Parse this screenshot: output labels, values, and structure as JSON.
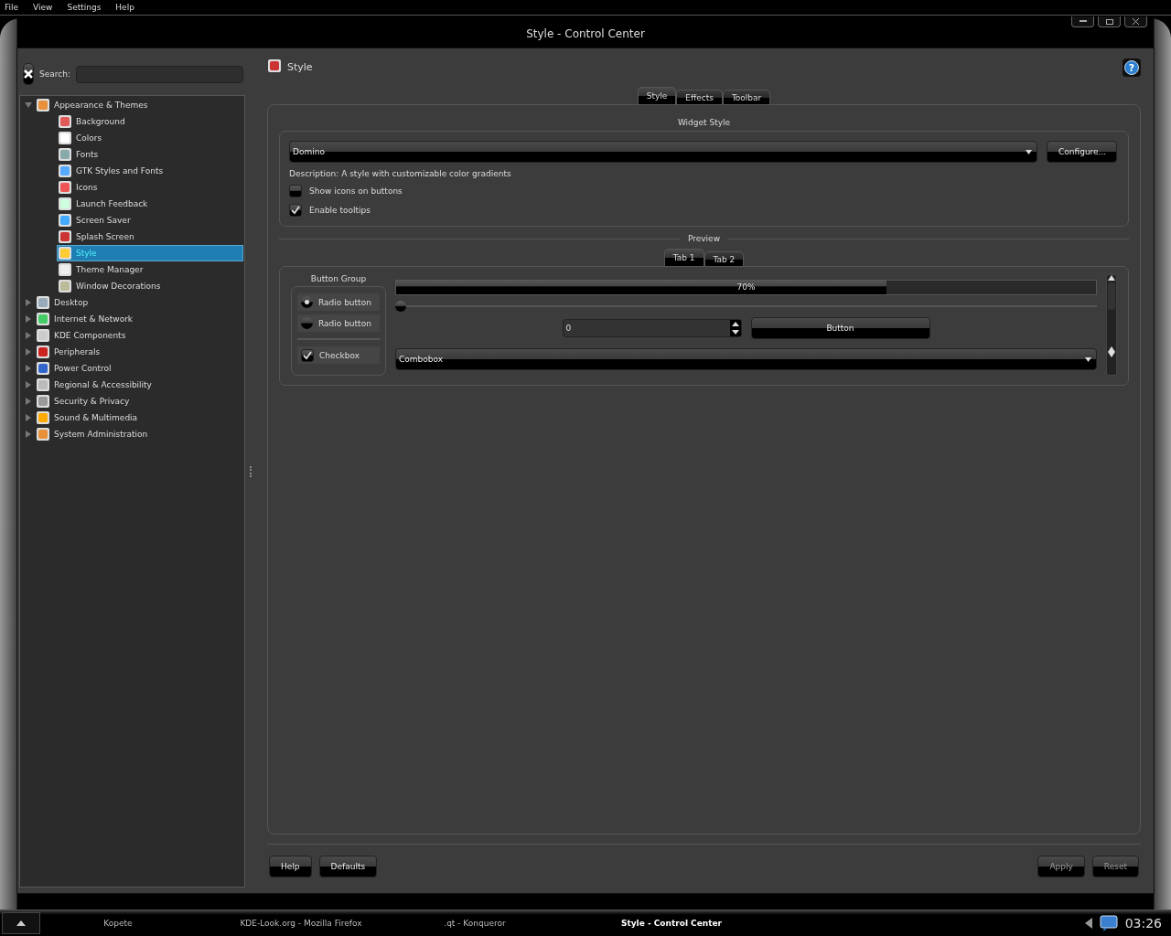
{
  "menubar": [
    "File",
    "View",
    "Settings",
    "Help"
  ],
  "window": {
    "title": "Style - Control Center"
  },
  "sidebar": {
    "search_label": "Search:"
  },
  "tree": [
    {
      "label": "Appearance & Themes",
      "expanded": true,
      "selected": false,
      "children": [
        {
          "label": "Background",
          "selected": false
        },
        {
          "label": "Colors",
          "selected": false
        },
        {
          "label": "Fonts",
          "selected": false
        },
        {
          "label": "GTK Styles and Fonts",
          "selected": false
        },
        {
          "label": "Icons",
          "selected": false
        },
        {
          "label": "Launch Feedback",
          "selected": false
        },
        {
          "label": "Screen Saver",
          "selected": false
        },
        {
          "label": "Splash Screen",
          "selected": false
        },
        {
          "label": "Style",
          "selected": true
        },
        {
          "label": "Theme Manager",
          "selected": false
        },
        {
          "label": "Window Decorations",
          "selected": false
        }
      ]
    },
    {
      "label": "Desktop",
      "expanded": false,
      "selected": false
    },
    {
      "label": "Internet & Network",
      "expanded": false,
      "selected": false
    },
    {
      "label": "KDE Components",
      "expanded": false,
      "selected": false
    },
    {
      "label": "Peripherals",
      "expanded": false,
      "selected": false
    },
    {
      "label": "Power Control",
      "expanded": false,
      "selected": false
    },
    {
      "label": "Regional & Accessibility",
      "expanded": false,
      "selected": false
    },
    {
      "label": "Security & Privacy",
      "expanded": false,
      "selected": false
    },
    {
      "label": "Sound & Multimedia",
      "expanded": false,
      "selected": false
    },
    {
      "label": "System Administration",
      "expanded": false,
      "selected": false
    }
  ],
  "page": {
    "title": "Style",
    "help_icon": "?"
  },
  "tabs": [
    {
      "label": "Style",
      "selected": true
    },
    {
      "label": "Effects",
      "selected": false
    },
    {
      "label": "Toolbar",
      "selected": false
    }
  ],
  "widget_style": {
    "heading": "Widget Style",
    "style_combo": "Domino",
    "configure": "Configure...",
    "description": "Description: A style with customizable color gradients",
    "options": [
      {
        "label": "Show icons on buttons",
        "checked": false
      },
      {
        "label": "Enable tooltips",
        "checked": true
      }
    ]
  },
  "preview": {
    "heading": "Preview",
    "tabs": [
      {
        "label": "Tab 1",
        "selected": true
      },
      {
        "label": "Tab 2",
        "selected": false
      }
    ],
    "group_title": "Button Group",
    "radios": [
      {
        "label": "Radio button",
        "selected": true
      },
      {
        "label": "Radio button",
        "selected": false
      }
    ],
    "checkbox": {
      "label": "Checkbox",
      "checked": true
    },
    "progress": {
      "level": 0.7,
      "reading": "70%"
    },
    "slider": {
      "level": 0
    },
    "spinbox": "0",
    "button": "Button",
    "combobox": "Combobox"
  },
  "buttons": [
    {
      "label": "Help",
      "disabled": false
    },
    {
      "label": "Defaults",
      "disabled": false
    },
    {
      "label": "Apply",
      "disabled": true
    },
    {
      "label": "Reset",
      "disabled": true
    }
  ],
  "taskbar": {
    "tasks": [
      {
        "label": "Kopete",
        "selected": false
      },
      {
        "label": "KDE-Look.org - Mozilla Firefox",
        "selected": false
      },
      {
        "label": ".qt - Konqueror",
        "selected": false
      },
      {
        "label": "Style - Control Center",
        "selected": true
      }
    ],
    "clock": "03:26"
  }
}
